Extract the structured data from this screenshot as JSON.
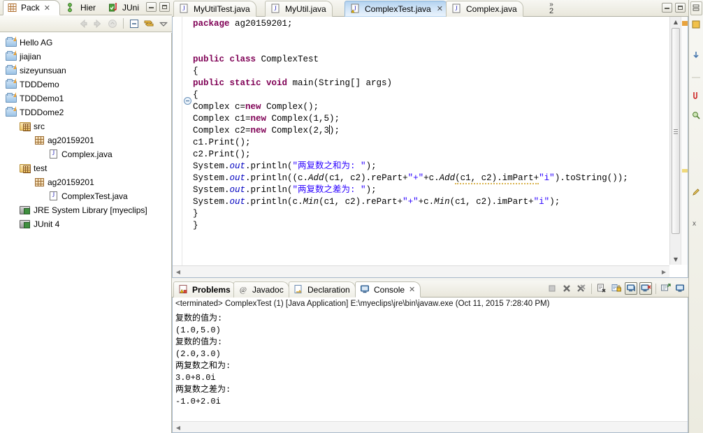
{
  "left_panel": {
    "view_tabs": [
      {
        "label": "Pack",
        "icon": "package-explorer-icon",
        "active": true,
        "closable": true
      },
      {
        "label": "Hier",
        "icon": "type-hierarchy-icon",
        "active": false,
        "closable": false
      },
      {
        "label": "JUni",
        "icon": "junit-icon",
        "active": false,
        "closable": false
      }
    ],
    "window_buttons": [
      "minimize",
      "maximize"
    ],
    "toolbar_icons": [
      "back-icon",
      "forward-icon",
      "collapse-home-icon",
      "collapse-all-icon",
      "link-with-editor-icon",
      "view-menu-icon"
    ],
    "tree": [
      {
        "label": "Hello AG",
        "icon": "java-project-icon",
        "indent": 1
      },
      {
        "label": "jiajian",
        "icon": "java-project-icon",
        "indent": 1
      },
      {
        "label": "sizeyunsuan",
        "icon": "java-project-icon",
        "indent": 1
      },
      {
        "label": "TDDDemo",
        "icon": "java-project-icon",
        "indent": 1
      },
      {
        "label": "TDDDemo1",
        "icon": "java-project-icon",
        "indent": 1
      },
      {
        "label": "TDDDome2",
        "icon": "java-project-icon",
        "indent": 1,
        "expanded": true
      },
      {
        "label": "src",
        "icon": "source-folder-icon",
        "indent": 2
      },
      {
        "label": "ag20159201",
        "icon": "package-icon",
        "indent": 3
      },
      {
        "label": "Complex.java",
        "icon": "java-file-icon",
        "indent": 4
      },
      {
        "label": "test",
        "icon": "source-folder-icon",
        "indent": 2
      },
      {
        "label": "ag20159201",
        "icon": "package-icon",
        "indent": 3
      },
      {
        "label": "ComplexTest.java",
        "icon": "java-file-icon",
        "indent": 4
      },
      {
        "label": "JRE System Library [myeclips]",
        "icon": "library-icon",
        "indent": 2
      },
      {
        "label": "JUnit 4",
        "icon": "library-icon",
        "indent": 2
      }
    ]
  },
  "editor": {
    "tabs": [
      {
        "label": "MyUtilTest.java",
        "active": false,
        "closable": false
      },
      {
        "label": "MyUtil.java",
        "active": false,
        "closable": false
      },
      {
        "label": "ComplexTest.java",
        "active": true,
        "closable": true
      },
      {
        "label": "Complex.java",
        "active": false,
        "closable": false
      }
    ],
    "overflow_chevron": "»",
    "overflow_count": "2",
    "window_buttons": [
      "minimize",
      "maximize"
    ],
    "code_lines": [
      [
        {
          "t": "package ",
          "c": "kw"
        },
        {
          "t": "ag20159201;",
          "c": "plain"
        }
      ],
      [],
      [],
      [
        {
          "t": "public class ",
          "c": "kw"
        },
        {
          "t": "ComplexTest",
          "c": "plain"
        }
      ],
      [
        {
          "t": "{",
          "c": "plain"
        }
      ],
      [
        {
          "t": "public static void ",
          "c": "kw"
        },
        {
          "t": "main(String[] args)",
          "c": "plain"
        }
      ],
      [
        {
          "t": "{",
          "c": "plain"
        }
      ],
      [
        {
          "t": "Complex c=",
          "c": "plain"
        },
        {
          "t": "new ",
          "c": "kw"
        },
        {
          "t": "Complex();",
          "c": "plain"
        }
      ],
      [
        {
          "t": "Complex c1=",
          "c": "plain"
        },
        {
          "t": "new ",
          "c": "kw"
        },
        {
          "t": "Complex(1,5);",
          "c": "plain"
        }
      ],
      [
        {
          "t": "Complex c2=",
          "c": "plain"
        },
        {
          "t": "new ",
          "c": "kw"
        },
        {
          "t": "Complex(2,3",
          "c": "plain"
        },
        {
          "t": "|",
          "c": "caret"
        },
        {
          "t": ");",
          "c": "plain"
        }
      ],
      [
        {
          "t": "c1.Print();",
          "c": "plain"
        }
      ],
      [
        {
          "t": "c2.Print();",
          "c": "plain"
        }
      ],
      [
        {
          "t": "System.",
          "c": "plain"
        },
        {
          "t": "out",
          "c": "fld"
        },
        {
          "t": ".println(",
          "c": "plain"
        },
        {
          "t": "\"两复数之和为: \"",
          "c": "str"
        },
        {
          "t": ");",
          "c": "plain"
        }
      ],
      [
        {
          "t": "System.",
          "c": "plain"
        },
        {
          "t": "out",
          "c": "fld"
        },
        {
          "t": ".println((c.",
          "c": "plain"
        },
        {
          "t": "Add",
          "c": "mth"
        },
        {
          "t": "(c1, c2).rePart+",
          "c": "plain"
        },
        {
          "t": "\"+\"",
          "c": "str"
        },
        {
          "t": "+c.",
          "c": "plain"
        },
        {
          "t": "Add",
          "c": "mth"
        },
        {
          "t": "(c1, c2).imPart+",
          "c": "plain"
        },
        {
          "t": "\"i\"",
          "c": "str"
        },
        {
          "t": ").toString());",
          "c": "plain"
        }
      ],
      [
        {
          "t": "System.",
          "c": "plain"
        },
        {
          "t": "out",
          "c": "fld"
        },
        {
          "t": ".println(",
          "c": "plain"
        },
        {
          "t": "\"两复数之差为: \"",
          "c": "str"
        },
        {
          "t": ");",
          "c": "plain"
        }
      ],
      [
        {
          "t": "System.",
          "c": "plain"
        },
        {
          "t": "out",
          "c": "fld"
        },
        {
          "t": ".println(c.",
          "c": "plain"
        },
        {
          "t": "Min",
          "c": "mth"
        },
        {
          "t": "(c1, c2).rePart+",
          "c": "plain"
        },
        {
          "t": "\"+\"",
          "c": "str"
        },
        {
          "t": "+c.",
          "c": "plain"
        },
        {
          "t": "Min",
          "c": "mth"
        },
        {
          "t": "(c1, c2).imPart+",
          "c": "plain"
        },
        {
          "t": "\"i\"",
          "c": "str"
        },
        {
          "t": ");",
          "c": "plain"
        }
      ],
      [
        {
          "t": "}",
          "c": "plain"
        }
      ],
      [
        {
          "t": "}",
          "c": "plain"
        }
      ]
    ],
    "highlight_line_index": 9
  },
  "console": {
    "tabs": [
      {
        "label": "Problems",
        "icon": "problems-icon",
        "active": false,
        "bold": true,
        "closable": false
      },
      {
        "label": "Javadoc",
        "icon": "javadoc-icon",
        "active": false,
        "bold": false,
        "closable": false
      },
      {
        "label": "Declaration",
        "icon": "declaration-icon",
        "active": false,
        "bold": false,
        "closable": false
      },
      {
        "label": "Console",
        "icon": "console-icon",
        "active": true,
        "bold": false,
        "closable": true
      }
    ],
    "toolbar_icons": [
      "terminate-icon",
      "remove-launch-icon",
      "remove-all-terminated-icon",
      "clear-console-icon",
      "scroll-lock-icon",
      "pin-console-icon",
      "display-selected-console-icon",
      "open-console-icon",
      "new-console-view-icon"
    ],
    "header": "<terminated> ComplexTest (1) [Java Application] E:\\myeclips\\jre\\bin\\javaw.exe (Oct 11, 2015 7:28:40 PM)",
    "output_lines": [
      "复数的值为:",
      "(1.0,5.0)",
      "复数的值为:",
      "(2.0,3.0)",
      "两复数之和为:",
      "3.0+8.0i",
      "两复数之差为:",
      "-1.0+2.0i"
    ]
  },
  "right_strip": {
    "icons": [
      "restore-icon",
      "outline-view-icon",
      "task-list-icon",
      "junit-view-icon",
      "search-view-icon"
    ]
  },
  "colors": {
    "keyword": "#7f0055",
    "string": "#2a00ff",
    "field": "#0000c0",
    "active_tab": "#b3d2ef",
    "panel_bg": "#f3f3ef",
    "editor_bg": "#ffffff",
    "occurrence_marker": "#b9d2ea"
  }
}
